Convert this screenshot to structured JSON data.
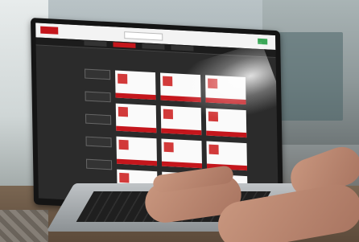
{
  "scene": {
    "subject": "laptop-on-workbench",
    "screen_theme": "dark",
    "accent_color": "#c4161c",
    "success_color": "#3aa757"
  },
  "screen": {
    "product_grid": {
      "columns": 3,
      "rows": 4
    }
  }
}
